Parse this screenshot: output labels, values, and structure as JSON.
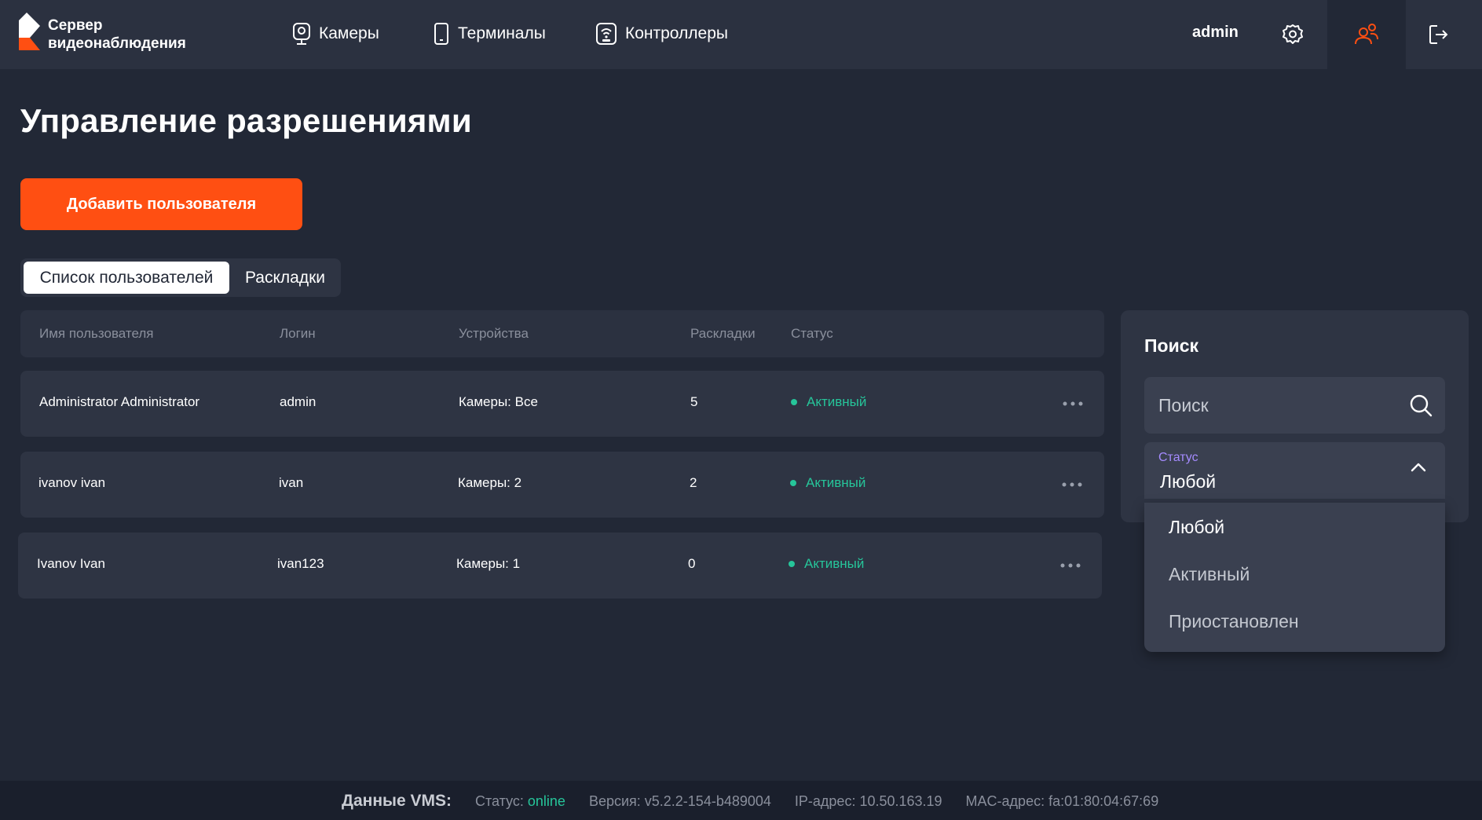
{
  "header": {
    "logo_line1": "Сервер",
    "logo_line2": "видеонаблюдения",
    "nav": [
      {
        "label": "Камеры",
        "icon": "camera-icon"
      },
      {
        "label": "Терминалы",
        "icon": "tablet-icon"
      },
      {
        "label": "Контроллеры",
        "icon": "controller-icon"
      }
    ],
    "username": "admin",
    "icons": [
      "gear-icon",
      "users-icon",
      "logout-icon"
    ],
    "active_icon": "users-icon"
  },
  "page": {
    "title": "Управление разрешениями",
    "add_button": "Добавить пользователя"
  },
  "tabs": [
    {
      "label": "Список пользователей",
      "active": true
    },
    {
      "label": "Раскладки",
      "active": false
    }
  ],
  "table": {
    "columns": [
      "Имя пользователя",
      "Логин",
      "Устройства",
      "Раскладки",
      "Статус"
    ],
    "rows": [
      {
        "name": "Administrator Administrator",
        "login": "admin",
        "devices": "Камеры: Все",
        "layouts": "5",
        "status": "Активный"
      },
      {
        "name": "ivanov ivan",
        "login": "ivan",
        "devices": "Камеры: 2",
        "layouts": "2",
        "status": "Активный"
      },
      {
        "name": "Ivanov Ivan",
        "login": "ivan123",
        "devices": "Камеры: 1",
        "layouts": "0",
        "status": "Активный"
      }
    ]
  },
  "search": {
    "title": "Поиск",
    "placeholder": "Поиск",
    "status_label": "Статус",
    "status_value": "Любой",
    "options": [
      "Любой",
      "Активный",
      "Приостановлен"
    ]
  },
  "footer": {
    "title": "Данные VMS:",
    "status_label": "Статус:",
    "status_value": "online",
    "version": "Версия: v5.2.2-154-b489004",
    "ip": "IP-адрес: 10.50.163.19",
    "mac": "MAC-адрес: fa:01:80:04:67:69"
  },
  "colors": {
    "background": "#222836",
    "header": "#2b3140",
    "accent": "#ff4f12",
    "active_status": "#26c59a",
    "select_label": "#a58bff"
  }
}
